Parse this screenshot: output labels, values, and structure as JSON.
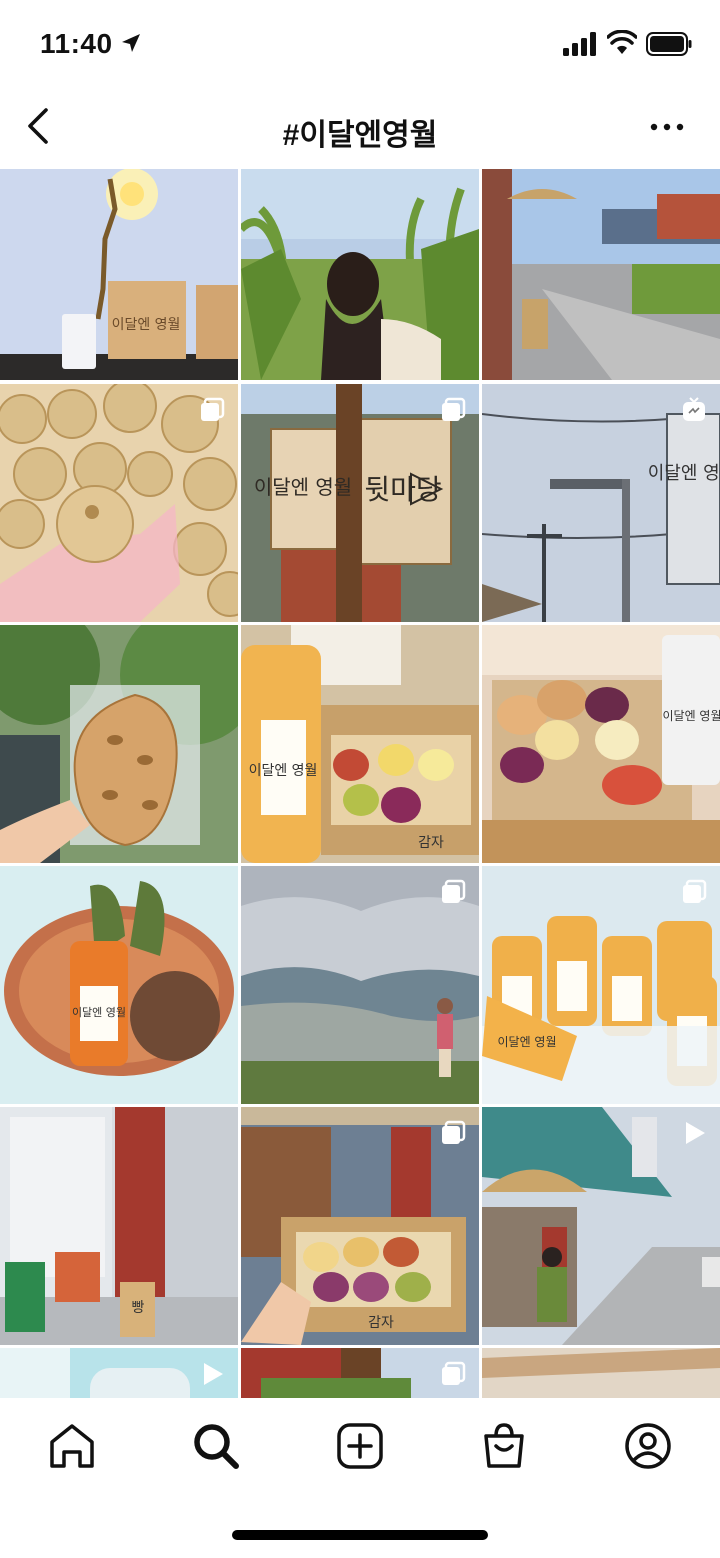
{
  "status_bar": {
    "time": "11:40",
    "icons": [
      "location-arrow-icon",
      "signal-icon",
      "wifi-icon",
      "battery-icon"
    ]
  },
  "header": {
    "title": "#이달엔영월",
    "back_icon": "chevron-left-icon",
    "more_icon": "more-horizontal-icon"
  },
  "tile_texts": {
    "sign_name": "이달엔 영월",
    "sign_back_yard": "뒷마당",
    "box_label": "감자",
    "bread_sign": "빵"
  },
  "grid": {
    "columns": 3,
    "posts": [
      {
        "subject": "lamp-and-cups",
        "badge": null
      },
      {
        "subject": "girl-in-cornfield",
        "badge": "multiple-icon"
      },
      {
        "subject": "street-with-shop",
        "badge": null
      },
      {
        "subject": "potato-bread-bag",
        "badge": "multiple-icon"
      },
      {
        "subject": "back-yard-sign",
        "badge": "multiple-icon"
      },
      {
        "subject": "shop-sign-sky",
        "badge": "igtv-icon"
      },
      {
        "subject": "focaccia-bag",
        "badge": null
      },
      {
        "subject": "juice-and-bread-box",
        "badge": null
      },
      {
        "subject": "bread-on-tray",
        "badge": null
      },
      {
        "subject": "juice-basket",
        "badge": null
      },
      {
        "subject": "mountain-view",
        "badge": "multiple-icon"
      },
      {
        "subject": "juice-bottles-ice",
        "badge": "multiple-icon"
      },
      {
        "subject": "shop-front",
        "badge": null
      },
      {
        "subject": "potato-bread-box",
        "badge": "multiple-icon"
      },
      {
        "subject": "street-with-parasol",
        "badge": "video-icon"
      },
      {
        "subject": "drink-partial",
        "badge": "video-icon"
      },
      {
        "subject": "cafe-partial",
        "badge": "multiple-icon"
      },
      {
        "subject": "interior-partial",
        "badge": null
      }
    ]
  },
  "bottom_nav": {
    "items": [
      {
        "name": "home",
        "icon": "home-icon"
      },
      {
        "name": "search",
        "icon": "search-icon",
        "active": true
      },
      {
        "name": "new-post",
        "icon": "plus-square-icon"
      },
      {
        "name": "shop",
        "icon": "shopping-bag-icon"
      },
      {
        "name": "profile",
        "icon": "profile-icon"
      }
    ]
  },
  "colors": {
    "background": "#ffffff",
    "text": "#111111",
    "sky": "#a9c6e8",
    "bread": "#d9b67a"
  }
}
